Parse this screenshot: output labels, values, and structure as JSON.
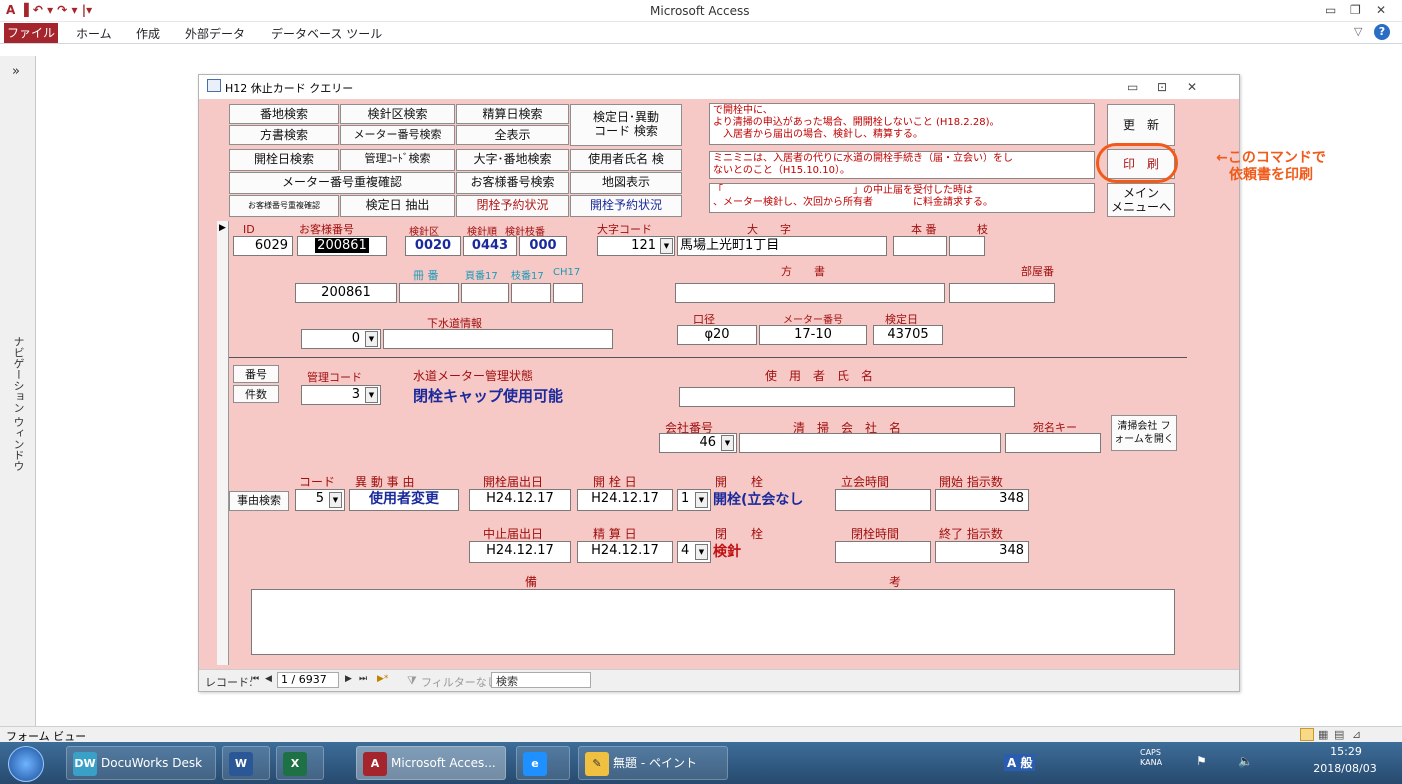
{
  "window": {
    "title": "Microsoft Access",
    "qat": "A ▐ ↶ ▾ ↷ ▾ |▾"
  },
  "ribbon": {
    "tabs": [
      "ファイル",
      "ホーム",
      "作成",
      "外部データ",
      "データベース ツール"
    ]
  },
  "navpane": {
    "toggle": "»",
    "label": "ナビゲーション ウィンドウ"
  },
  "form": {
    "title": "H12 休止カード クエリー",
    "buttons": {
      "b1": "番地検索",
      "b2": "検針区検索",
      "b3": "精算日検索",
      "b4": "検定日･異動\nコード 検索",
      "b5": "方書検索",
      "b6": "メーター番号検索",
      "b7": "全表示",
      "b8": "開栓日検索",
      "b9": "管理ｺｰﾄﾞ検索",
      "b10": "大字･番地検索",
      "b11": "使用者氏名 検",
      "b12": "メーター番号重複確認",
      "b13": "お客様番号検索",
      "b14": "地図表示",
      "b15": "お客様番号重複確認",
      "b16": "検定日 抽出",
      "b17": "閉栓予約状況",
      "b18": "開栓予約状況",
      "update": "更　新",
      "print": "印　刷",
      "main_menu": "メイン\nメニューへ",
      "bangou": "番号",
      "kensu": "件数",
      "jiyu": "事由検索",
      "seisou": "清掃会社 フ\nォームを開く"
    },
    "memos": {
      "m1": "で開栓中に、\nより清掃の申込があった場合、開開栓しないこと (H18.2.28)。\n　入居者から届出の場合、検針し、精算する。",
      "m2": "ミニミニは、入居者の代りに水道の開栓手続き（届・立会い）をし\nないとのこと（H15.10.10）。",
      "m3": "「　　　　　　　　　　　　　」の中止届を受付した時は\n、メーター検針し、次回から所有者　　　　に料金請求する。"
    },
    "annotation": "←このコマンドで\n依頼書を印刷",
    "labels": {
      "id": "ID",
      "okyaku": "お客様番号",
      "kenshinku": "検針区",
      "kenshinjun": "検針順",
      "kenshinedaban": "検針枝番",
      "oaza_code": "大字コード",
      "oaza": "大　　字",
      "honban": "本 番",
      "eda": "枝",
      "satsuban": "冊 番",
      "tokuban17": "頁番17",
      "edaban17": "枝番17",
      "ch17": "CH17",
      "katagaki": "方　　書",
      "heya": "部屋番",
      "gesui": "下水道情報",
      "koukei": "口径",
      "meter_no": "メーター番号",
      "kentei": "検定日",
      "kanri_code": "管理コード",
      "meter_status": "水道メーター管理状態",
      "shiyousha": "使　用　者　氏　名",
      "kaisha_no": "会社番号",
      "seisou_kaisha": "清　掃　会　社　名",
      "atena": "宛名キー",
      "code": "コード",
      "idou_jiyu": "異 動 事 由",
      "kaisen_todoke": "開栓届出日",
      "kaisen_bi": "開 栓 日",
      "kaisen": "開　　栓",
      "tachiai": "立会時間",
      "kaishi": "開始 指示数",
      "chushi_todoke": "中止届出日",
      "seisan_bi": "精 算 日",
      "heisen": "閉　　栓",
      "heisen_jikan": "閉栓時間",
      "shuryo": "終了 指示数",
      "biko": "備",
      "ko": "考"
    },
    "values": {
      "id": "6029",
      "okyaku": "200861",
      "kenshinku": "0020",
      "kenshinjun": "0443",
      "kenshinedaban": "000",
      "oaza_code": "121",
      "oaza": "馬場上光町1丁目",
      "satsuban": "200861",
      "gesui": "0",
      "koukei": "φ20",
      "meter_no": "17-10",
      "kentei": "43705",
      "kanri_code": "3",
      "meter_status": "閉栓キャップ使用可能",
      "kaisha_no": "46",
      "code": "5",
      "idou_jiyu": "使用者変更",
      "kaisen_todoke": "H24.12.17",
      "kaisen_bi": "H24.12.17",
      "kaisen_code": "1",
      "kaisen_status": "開栓(立会なし",
      "kaishi": "348",
      "chushi_todoke": "H24.12.17",
      "seisan_bi": "H24.12.17",
      "heisen_code": "4",
      "heisen_status": "検針",
      "shuryo": "348"
    },
    "nav": {
      "record_label": "レコード:",
      "first": "⏮",
      "prev": "◀",
      "position": "1 / 6937",
      "next": "▶",
      "last": "⏭",
      "new": "▶*",
      "filter": "フィルターなし",
      "search": "検索"
    }
  },
  "statusbar": {
    "view": "フォーム ビュー"
  },
  "taskbar": {
    "items": [
      "DocuWorks Desk",
      "",
      "",
      "Microsoft Acces...",
      "",
      "無題 - ペイント"
    ],
    "time": "15:29",
    "date": "2018/08/03",
    "ime": "A 般",
    "caps": "CAPS\nKANA"
  }
}
